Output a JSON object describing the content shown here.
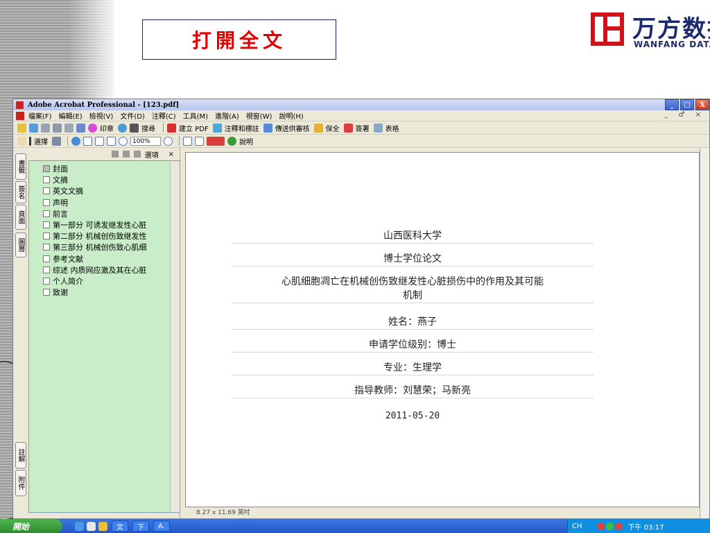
{
  "slide": {
    "title": "打開全文",
    "logo": {
      "cn": "万方数据",
      "en": "WANFANG DATA"
    }
  },
  "window": {
    "title": "Adobe Acrobat Professional - [123.pdf]",
    "controls": [
      "_",
      "□",
      "X"
    ]
  },
  "menubar": {
    "items": [
      "檔案(F)",
      "編輯(E)",
      "檢視(V)",
      "文件(D)",
      "注釋(C)",
      "工具(M)",
      "進階(A)",
      "視窗(W)",
      "說明(H)"
    ],
    "right": "_ ♂ ×"
  },
  "toolbar1": {
    "print_label": "印章",
    "search_label": "搜尋",
    "create_pdf_label": "建立 PDF",
    "comment_label": "注釋和標註",
    "send_review_label": "傳送供審核",
    "secure_label": "保全",
    "sign_label": "簽署",
    "forms_label": "表格"
  },
  "toolbar2": {
    "select_label": "選擇",
    "zoom_value": "100%",
    "help_label": "說明"
  },
  "side_tabs": [
    "書籤",
    "簽名",
    "頁面",
    "圖層",
    "註解",
    "附件"
  ],
  "nav_panel": {
    "options_label": "選項",
    "bookmarks": [
      "封面",
      "文摘",
      "英文文摘",
      "声明",
      "前言",
      "第一部分 可诱发继发性心脏",
      "第二部分 机械创伤致继发性",
      "第三部分 机械创伤致心肌细",
      "参考文献",
      "综述 内质网应激及其在心脏",
      "个人简介",
      "致谢"
    ]
  },
  "document": {
    "university": "山西医科大学",
    "degree_type": "博士学位论文",
    "thesis_title_line1": "心肌细胞凋亡在机械创伤致继发性心脏损伤中的作用及其可能",
    "thesis_title_line2": "机制",
    "name": "姓名：燕子",
    "degree_level": "申请学位级别：博士",
    "major": "专业：生理学",
    "advisor": "指导教师：刘慧荣；马新亮",
    "date": "2011-05-20"
  },
  "statusbar": {
    "page_size": "8.27 x 11.69 英吋"
  },
  "taskbar": {
    "start_label": "開始",
    "tasks": [
      "文",
      "下",
      "A."
    ],
    "language": "CH",
    "clock": "下午 03:17"
  }
}
